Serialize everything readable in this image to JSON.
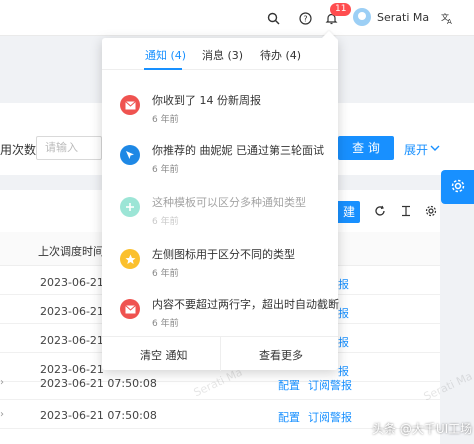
{
  "header": {
    "badge_count": "11",
    "username": "Serati Ma"
  },
  "filter": {
    "runs_label": "用次数:",
    "input_placeholder": "请输入",
    "query_label": "查 询",
    "expand_label": "展开"
  },
  "table": {
    "new_label": "建",
    "time_header": "上次调度时间",
    "rows": [
      {
        "time": "2023-06-21",
        "config": "",
        "alarm": "报"
      },
      {
        "time": "2023-06-21",
        "config": "",
        "alarm": "报"
      },
      {
        "time": "2023-06-21",
        "config": "",
        "alarm": "报"
      },
      {
        "time": "2023-06-21",
        "config": "",
        "alarm": "报"
      },
      {
        "time": "2023-06-21 07:50:08",
        "config": "配置",
        "alarm": "订阅警报"
      },
      {
        "time": "2023-06-21 07:50:08",
        "config": "配置",
        "alarm": "订阅警报"
      }
    ]
  },
  "watermark": "Serati Ma",
  "notifications": {
    "tabs": [
      {
        "label": "通知 (4)",
        "active": true
      },
      {
        "label": "消息 (3)",
        "active": false
      },
      {
        "label": "待办 (4)",
        "active": false
      }
    ],
    "items": [
      {
        "title": "你收到了 14 份新周报",
        "time": "6 年前",
        "icon": "mail-icon",
        "color": "#ef5350"
      },
      {
        "title": "你推荐的 曲妮妮 已通过第三轮面试",
        "time": "6 年前",
        "icon": "cursor-icon",
        "color": "#1e88e5"
      },
      {
        "title": "这种模板可以区分多种通知类型",
        "time": "6 年前",
        "icon": "plus-icon",
        "color": "#26c6a6"
      },
      {
        "title": "左侧图标用于区分不同的类型",
        "time": "6 年前",
        "icon": "star-icon",
        "color": "#fbc02d"
      },
      {
        "title": "内容不要超过两行字，超出时自动截断",
        "time": "6 年前",
        "icon": "mail-icon",
        "color": "#ef5350"
      }
    ],
    "clear_label": "清空 通知",
    "more_label": "查看更多"
  },
  "brand": "头条 @大千UI工场"
}
